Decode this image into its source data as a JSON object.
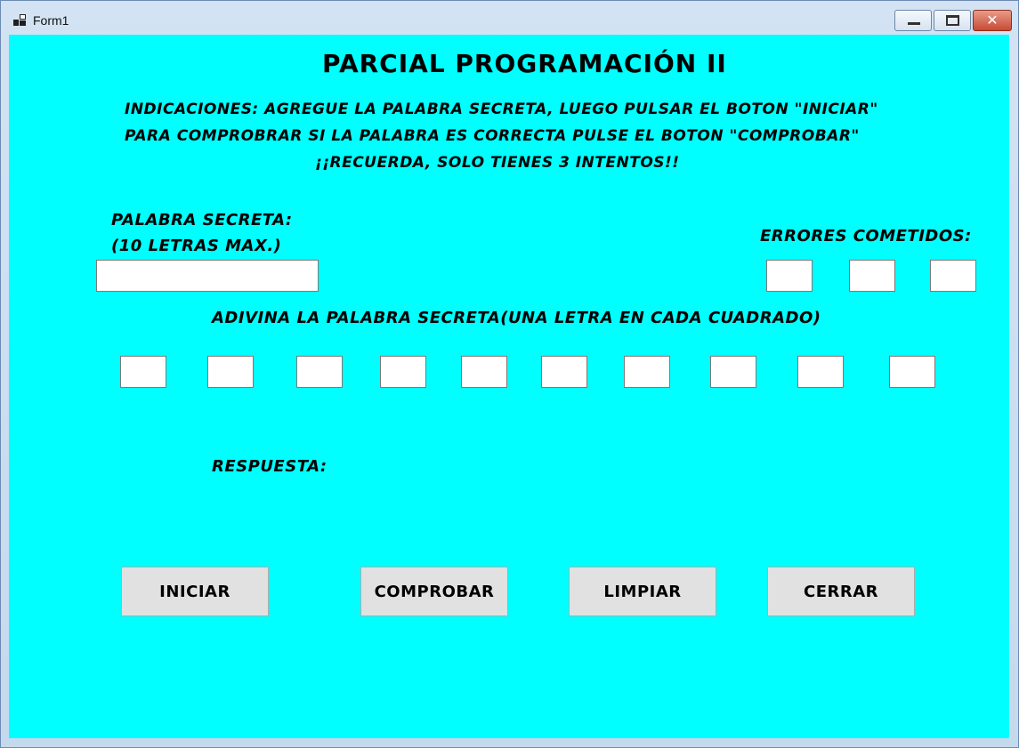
{
  "window": {
    "title": "Form1"
  },
  "form": {
    "heading": "PARCIAL PROGRAMACIÓN II",
    "instructions": [
      "INDICACIONES: AGREGUE LA PALABRA SECRETA, LUEGO PULSAR EL BOTON \"INICIAR\"",
      "PARA COMPROBRAR SI LA PALABRA ES CORRECTA PULSE EL BOTON \"COMPROBAR\"",
      "¡¡RECUERDA, SOLO TIENES 3 INTENTOS!!"
    ],
    "secret_label_line1": "PALABRA SECRETA:",
    "secret_label_line2": "(10 LETRAS MAX.)",
    "secret_value": "",
    "errors_label": "ERRORES COMETIDOS:",
    "error_boxes": [
      "",
      "",
      ""
    ],
    "guess_label": "ADIVINA LA PALABRA SECRETA(UNA LETRA EN CADA CUADRADO)",
    "letter_boxes": [
      "",
      "",
      "",
      "",
      "",
      "",
      "",
      "",
      "",
      ""
    ],
    "answer_label": "RESPUESTA:",
    "answer_value": ""
  },
  "buttons": {
    "start": "INICIAR",
    "check": "COMPROBAR",
    "clear": "LIMPIAR",
    "close": "CERRAR"
  },
  "icons": {
    "app": "window-app-icon",
    "minimize": "minimize-icon",
    "maximize": "maximize-icon",
    "close": "close-icon"
  }
}
